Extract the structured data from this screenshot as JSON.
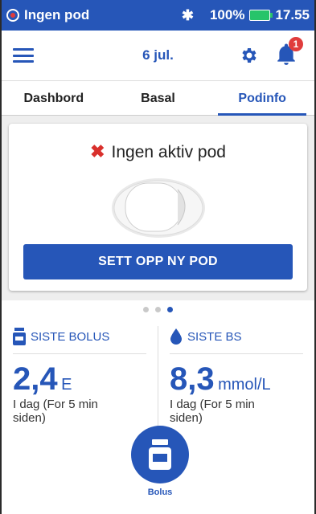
{
  "status_bar": {
    "pod_status": "Ingen pod",
    "bluetooth": "bluetooth-icon",
    "battery": "100%",
    "time": "17.55"
  },
  "header": {
    "date": "6 jul.",
    "notifications": "1"
  },
  "tabs": [
    {
      "label": "Dashbord"
    },
    {
      "label": "Basal"
    },
    {
      "label": "Podinfo"
    }
  ],
  "pod_card": {
    "title": "Ingen aktiv pod",
    "button": "SETT OPP NY POD"
  },
  "pager": {
    "pages": 3,
    "active": 3
  },
  "last_bolus": {
    "label": "SISTE BOLUS",
    "value": "2,4",
    "unit": "E",
    "when": "I dag (For 5 min siden)"
  },
  "last_bg": {
    "label": "SISTE BS",
    "value": "8,3",
    "unit": "mmol/L",
    "when": "I dag (For 5 min siden)"
  },
  "bolus_button": {
    "label": "Bolus"
  },
  "colors": {
    "primary": "#2656b8",
    "alert": "#e03c3c",
    "battery": "#27c46a"
  }
}
